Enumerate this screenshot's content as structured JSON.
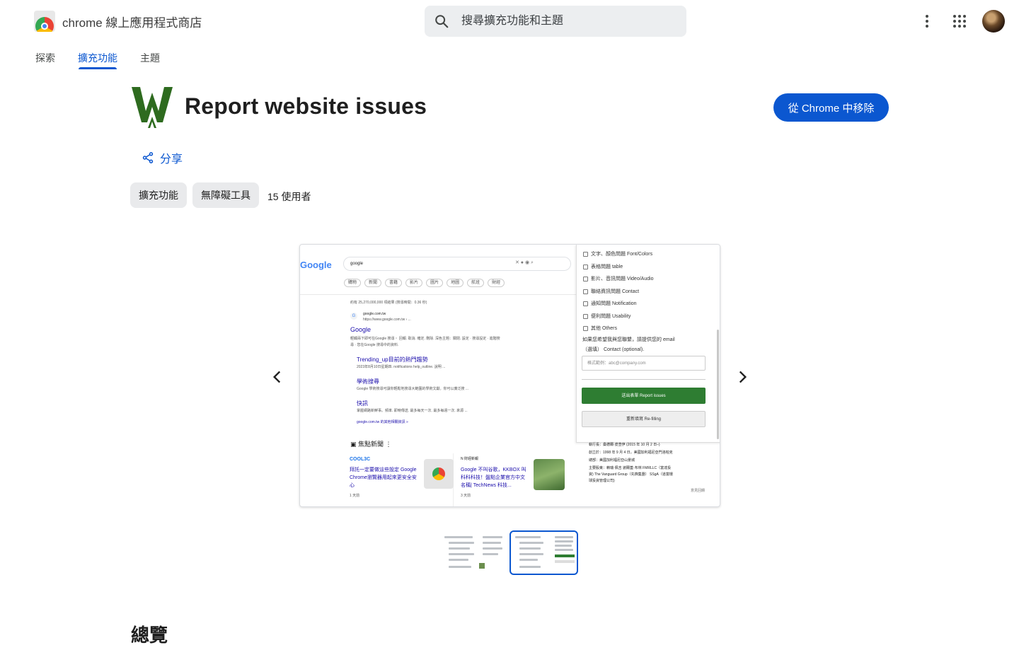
{
  "header": {
    "store_title": "chrome 線上應用程式商店",
    "search_placeholder": "搜尋擴充功能和主題",
    "icons": [
      "chrome-web-store-logo-icon",
      "search-icon",
      "more-vert-icon",
      "apps-grid-icon",
      "account-avatar"
    ]
  },
  "nav": {
    "tabs": [
      {
        "label": "探索",
        "active": false
      },
      {
        "label": "擴充功能",
        "active": true
      },
      {
        "label": "主題",
        "active": false
      }
    ]
  },
  "extension": {
    "title": "Report website issues",
    "remove_button": "從 Chrome 中移除",
    "share_label": "分享",
    "chips": [
      "擴充功能",
      "無障礙工具"
    ],
    "users": "15 使用者"
  },
  "carousel": {
    "selected_index": 1,
    "thumbnail_count": 2,
    "screenshot": {
      "google_logo": "Google",
      "query": "google",
      "filters": [
        "購物",
        "新聞",
        "書籍",
        "影片",
        "圖片",
        "地圖",
        "航班",
        "財經"
      ],
      "result_count": "約有 25,270,000,000 項結果 (搜尋時間：0.36 秒)",
      "site_domain": "google.com.tw",
      "site_url": "https://www.google.com.tw › ...",
      "result_title": "Google",
      "result_snippet_1": "輕觸兩下即可在Google 搜尋・ 回報. 取消. 確定. 刪除. 深色主題：關閉. 設定 · 搜尋設定 · 進階搜",
      "result_snippet_2": "尋 · 您在Google 搜尋中的資料.",
      "sub_results": [
        {
          "title": "Trending_up目前的熱門趨勢",
          "snippet": "2023年8月10日星期四. notifications help_outline. 說明 ..."
        },
        {
          "title": "學術搜尋",
          "snippet": "Google 學術搜尋可讓你輕鬆地搜尋大範圍的學術文獻。你可以廣泛搜 ..."
        },
        {
          "title": "快訊",
          "snippet": "掌握網路新鮮事。頻率. 即時傳送. 最多每天一次. 最多每週一次. 來源 ..."
        }
      ],
      "more_results": "google.com.tw 的其他相關資訊 »",
      "news_heading": "焦點新聞",
      "news": [
        {
          "source": "COOL3C",
          "title": "拜託一定要做這些設定 Google Chrome瀏覽器用起來更安全安心",
          "age": "1 天前"
        },
        {
          "source": "N 財經新報",
          "title": "Google 不叫谷歌，KKBOX 叫科科科技！盤點企業官方中文名稱| TechNews 科技...",
          "age": "3 天前"
        }
      ],
      "form_options": [
        "文字、顏色問題 Font/Colors",
        "表格問題 table",
        "影片、音訊問題 Video/Audio",
        "聯絡資訊問題 Contact",
        "通知問題 Notification",
        "便利問題 Usability",
        "其他 Others"
      ],
      "email_prompt_1": "如果您希望我與您聯繫，請提供您的 email",
      "email_prompt_2": "（選填） Contact (optional).",
      "email_placeholder": "格式範例：abc@company.com",
      "submit_label": "送出表單 Report issues",
      "reset_label": "重新填寫 Re-filling",
      "kp_lines": [
        "執行長：桑德爾·皮查伊 (2015 年 10 月 2 日–)",
        "創立於：1998 年 9 月 4 日，美國加利福尼亞門洛帕克",
        "總部：美國加利福尼亞山景城",
        "主要股東：賴瑞·佩吉 謝爾蓋·布林 FMRLLC（富達投",
        "資) The Vanguard Group（先鋒集團） SSgA（道富環",
        "球投資管理公司)"
      ],
      "feedback": "意見回饋"
    }
  },
  "overview": {
    "heading": "總覽"
  },
  "colors": {
    "accent": "#0b57d0",
    "brand_green": "#2e7d32",
    "chip_bg": "#e9eaec"
  }
}
